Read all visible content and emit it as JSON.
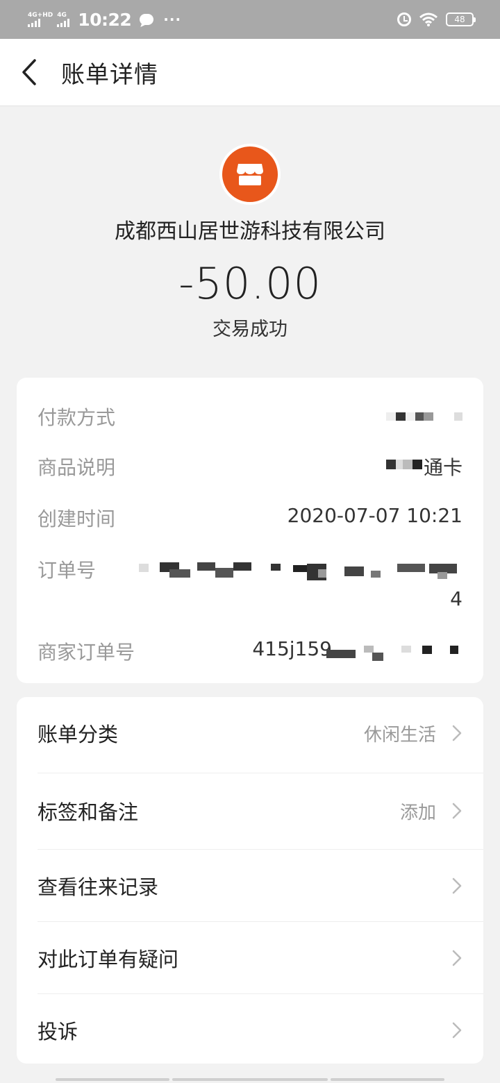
{
  "status_bar": {
    "network1": "4G+HD",
    "network2": "4G",
    "time": "10:22",
    "more": "···",
    "battery": "48"
  },
  "nav": {
    "title": "账单详情",
    "back_icon": "chevron-left-icon"
  },
  "header": {
    "merchant_icon": "store-icon",
    "merchant_name": "成都西山居世游科技有限公司",
    "amount": "-50.00",
    "status": "交易成功",
    "accent_color": "#e8571b"
  },
  "details": [
    {
      "label": "付款方式",
      "value": ""
    },
    {
      "label": "商品说明",
      "value": "通卡"
    },
    {
      "label": "创建时间",
      "value": "2020-07-07 10:21"
    },
    {
      "label": "订单号",
      "value": "4"
    },
    {
      "label": "商家订单号",
      "value": "415j159"
    }
  ],
  "actions": [
    {
      "label": "账单分类",
      "value": "休闲生活"
    },
    {
      "label": "标签和备注",
      "value": "添加"
    },
    {
      "label": "查看往来记录",
      "value": ""
    },
    {
      "label": "对此订单有疑问",
      "value": ""
    },
    {
      "label": "投诉",
      "value": ""
    }
  ]
}
